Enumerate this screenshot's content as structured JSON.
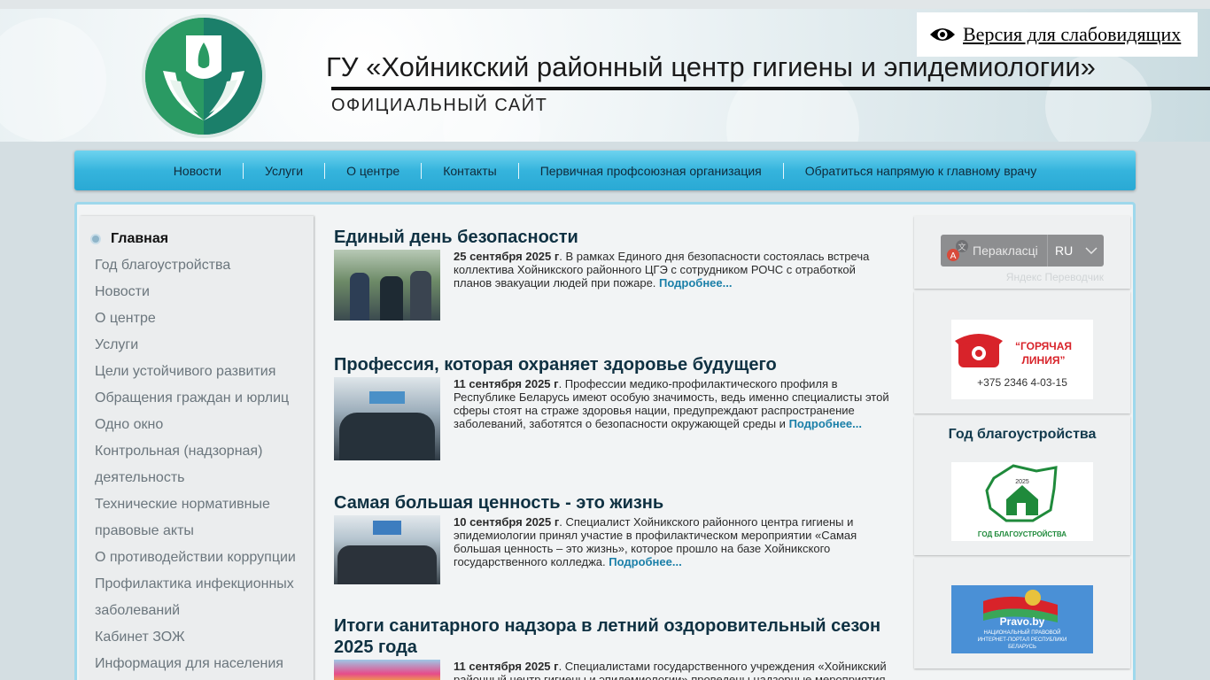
{
  "header": {
    "title": "ГУ «Хойникский районный центр гигиены и эпидемиологии»",
    "subtitle": "ОФИЦИАЛЬНЫЙ САЙТ",
    "vision_label": "Версия для слабовидящих"
  },
  "nav": {
    "items": [
      "Новости",
      "Услуги",
      "О центре",
      "Контакты",
      "Первичная профсоюзная организация",
      "Обратиться напрямую к главному врачу"
    ]
  },
  "sidebar": {
    "home": "Главная",
    "items": [
      "Год благоустройства",
      "Новости",
      "О центре",
      "Услуги",
      "Цели устойчивого развития",
      "Обращения граждан и юрлиц",
      "Одно окно",
      "Контрольная (надзорная)",
      "деятельность",
      "Технические нормативные",
      "правовые акты",
      "О противодействии коррупции",
      "Профилактика инфекционных",
      "заболеваний",
      "Кабинет ЗОЖ",
      "Информация для населения"
    ]
  },
  "posts": [
    {
      "title": "Единый день безопасности",
      "date": "25 сентября 2025 г",
      "text": ". В рамках Единого дня безопасности состоялась встреча коллектива Хойникского районного ЦГЭ с сотрудником РОЧС с отработкой планов эвакуации людей при пожаре.",
      "more": "Подробнее..."
    },
    {
      "title": "Профессия, которая охраняет здоровье будущего",
      "date": "11 сентября 2025 г",
      "text": ". Профессии медико-профилактического профиля в Республике Беларусь имеют особую значимость, ведь именно специалисты этой сферы стоят на страже здоровья нации, предупреждают распространение заболеваний, заботятся о безопасности окружающей среды и",
      "more": "Подробнее..."
    },
    {
      "title": "Самая большая ценность - это жизнь",
      "date": "10 сентября 2025 г",
      "text": ". Специалист Хойникского районного центра гигиены и эпидемиологии принял участие в профилактическом мероприятии «Самая большая ценность – это жизнь», которое прошло на базе Хойникского государственного колледжа.",
      "more": "Подробнее..."
    },
    {
      "title": "Итоги санитарного надзора в летний оздоровительный сезон 2025 года",
      "date": "11 сентября 2025 г",
      "text": ". Специалистами государственного учреждения «Хойникский районный центр гигиены и эпидемиологии» проведены надзорные мероприятия",
      "more": ""
    }
  ],
  "right": {
    "translate_label": "Перакласці",
    "translate_lang": "RU",
    "translate_credit": "Яндекс Переводчик",
    "hotline_title": "“ГОРЯЧАЯ ЛИНИЯ”",
    "hotline_phone": "+375 2346 4-03-15",
    "year_title": "Год благоустройства",
    "year_badge_year": "2025",
    "year_badge_text": "ГОД БЛАГОУСТРОЙСТВА",
    "pravo_name": "Pravo.by",
    "pravo_sub": "НАЦИОНАЛЬНЫЙ ПРАВОВОЙ ИНТЕРНЕТ-ПОРТАЛ РЕСПУБЛИКИ БЕЛАРУСЬ"
  },
  "colors": {
    "nav_accent": "#35b4dd",
    "title_color": "#0f3142",
    "more_link": "#1a7fa8",
    "logo_green": "#1f8f5f"
  }
}
